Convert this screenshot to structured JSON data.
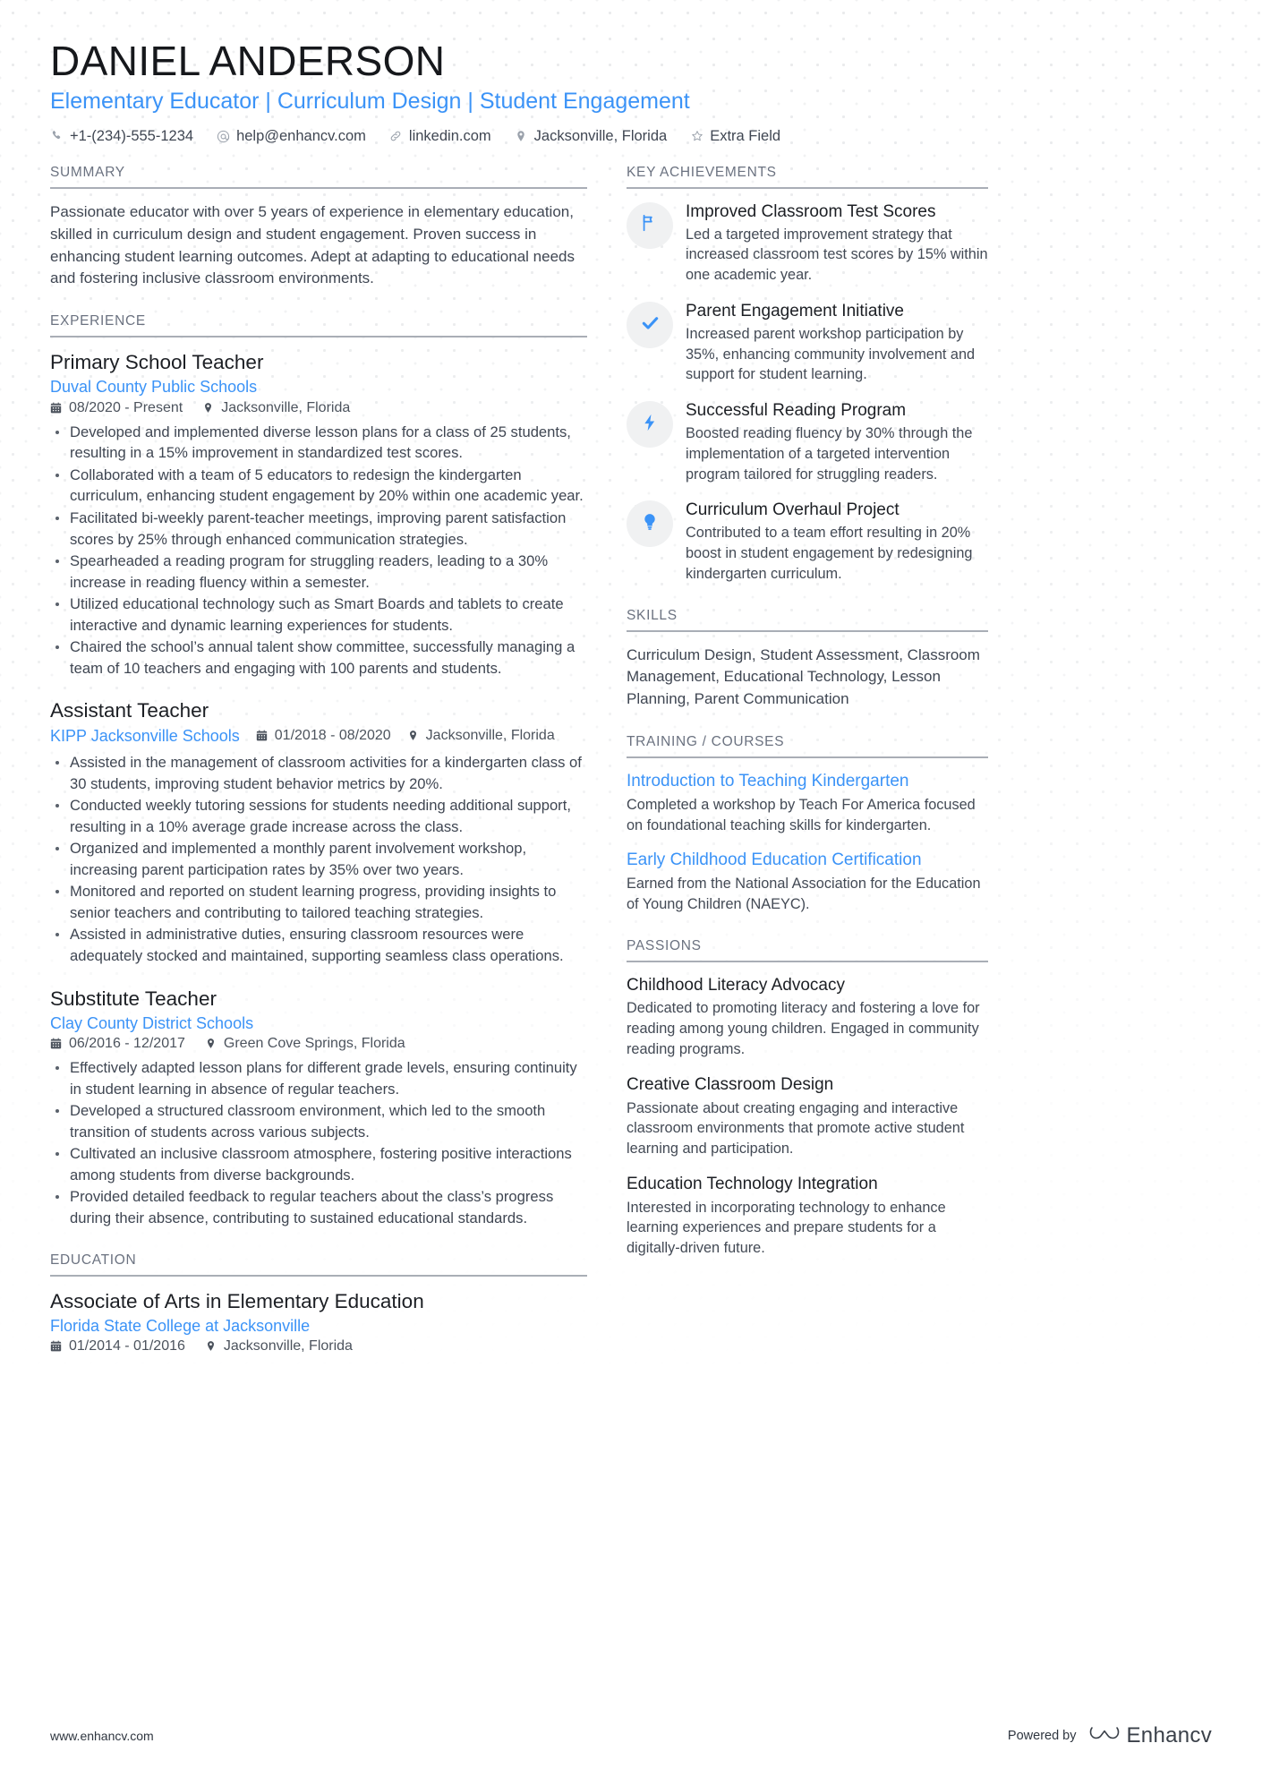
{
  "header": {
    "name": "DANIEL ANDERSON",
    "headline": "Elementary Educator | Curriculum Design | Student Engagement",
    "contacts": [
      {
        "icon": "phone-icon",
        "text": "+1-(234)-555-1234"
      },
      {
        "icon": "email-icon",
        "text": "help@enhancv.com"
      },
      {
        "icon": "link-icon",
        "text": "linkedin.com"
      },
      {
        "icon": "location-icon",
        "text": "Jacksonville, Florida"
      },
      {
        "icon": "star-icon",
        "text": "Extra Field"
      }
    ]
  },
  "summary": {
    "title": "SUMMARY",
    "text": "Passionate educator with over 5 years of experience in elementary education, skilled in curriculum design and student engagement. Proven success in enhancing student learning outcomes. Adept at adapting to educational needs and fostering inclusive classroom environments."
  },
  "experience": {
    "title": "EXPERIENCE",
    "jobs": [
      {
        "title": "Primary School Teacher",
        "company": "Duval County Public Schools",
        "dates": "08/2020 - Present",
        "location": "Jacksonville, Florida",
        "inline_meta": false,
        "bullets": [
          "Developed and implemented diverse lesson plans for a class of 25 students, resulting in a 15% improvement in standardized test scores.",
          "Collaborated with a team of 5 educators to redesign the kindergarten curriculum, enhancing student engagement by 20% within one academic year.",
          "Facilitated bi-weekly parent-teacher meetings, improving parent satisfaction scores by 25% through enhanced communication strategies.",
          "Spearheaded a reading program for struggling readers, leading to a 30% increase in reading fluency within a semester.",
          "Utilized educational technology such as Smart Boards and tablets to create interactive and dynamic learning experiences for students.",
          "Chaired the school’s annual talent show committee, successfully managing a team of 10 teachers and engaging with 100 parents and students."
        ]
      },
      {
        "title": "Assistant Teacher",
        "company": "KIPP Jacksonville Schools",
        "dates": "01/2018 - 08/2020",
        "location": "Jacksonville, Florida",
        "inline_meta": true,
        "bullets": [
          "Assisted in the management of classroom activities for a kindergarten class of 30 students, improving student behavior metrics by 20%.",
          "Conducted weekly tutoring sessions for students needing additional support, resulting in a 10% average grade increase across the class.",
          "Organized and implemented a monthly parent involvement workshop, increasing parent participation rates by 35% over two years.",
          "Monitored and reported on student learning progress, providing insights to senior teachers and contributing to tailored teaching strategies.",
          "Assisted in administrative duties, ensuring classroom resources were adequately stocked and maintained, supporting seamless class operations."
        ]
      },
      {
        "title": "Substitute Teacher",
        "company": "Clay County District Schools",
        "dates": "06/2016 - 12/2017",
        "location": "Green Cove Springs, Florida",
        "inline_meta": false,
        "bullets": [
          "Effectively adapted lesson plans for different grade levels, ensuring continuity in student learning in absence of regular teachers.",
          "Developed a structured classroom environment, which led to the smooth transition of students across various subjects.",
          "Cultivated an inclusive classroom atmosphere, fostering positive interactions among students from diverse backgrounds.",
          "Provided detailed feedback to regular teachers about the class’s progress during their absence, contributing to sustained educational standards."
        ]
      }
    ]
  },
  "education": {
    "title": "EDUCATION",
    "entries": [
      {
        "degree": "Associate of Arts in Elementary Education",
        "school": "Florida State College at Jacksonville",
        "dates": "01/2014 - 01/2016",
        "location": "Jacksonville, Florida"
      }
    ]
  },
  "achievements": {
    "title": "KEY ACHIEVEMENTS",
    "items": [
      {
        "icon": "flag-icon",
        "title": "Improved Classroom Test Scores",
        "desc": "Led a targeted improvement strategy that increased classroom test scores by 15% within one academic year."
      },
      {
        "icon": "check-icon",
        "title": "Parent Engagement Initiative",
        "desc": "Increased parent workshop participation by 35%, enhancing community involvement and support for student learning."
      },
      {
        "icon": "bolt-icon",
        "title": "Successful Reading Program",
        "desc": "Boosted reading fluency by 30% through the implementation of a targeted intervention program tailored for struggling readers."
      },
      {
        "icon": "lightbulb-icon",
        "title": "Curriculum Overhaul Project",
        "desc": "Contributed to a team effort resulting in 20% boost in student engagement by redesigning kindergarten curriculum."
      }
    ]
  },
  "skills": {
    "title": "SKILLS",
    "text": "Curriculum Design, Student Assessment, Classroom Management, Educational Technology, Lesson Planning, Parent Communication"
  },
  "training": {
    "title": "TRAINING / COURSES",
    "items": [
      {
        "title": "Introduction to Teaching Kindergarten",
        "desc": "Completed a workshop by Teach For America focused on foundational teaching skills for kindergarten."
      },
      {
        "title": "Early Childhood Education Certification",
        "desc": "Earned from the National Association for the Education of Young Children (NAEYC)."
      }
    ]
  },
  "passions": {
    "title": "PASSIONS",
    "items": [
      {
        "title": "Childhood Literacy Advocacy",
        "desc": "Dedicated to promoting literacy and fostering a love for reading among young children. Engaged in community reading programs."
      },
      {
        "title": "Creative Classroom Design",
        "desc": "Passionate about creating engaging and interactive classroom environments that promote active student learning and participation."
      },
      {
        "title": "Education Technology Integration",
        "desc": "Interested in incorporating technology to enhance learning experiences and prepare students for a digitally-driven future."
      }
    ]
  },
  "footer": {
    "url": "www.enhancv.com",
    "powered_by": "Powered by",
    "brand": "Enhancv"
  },
  "colors": {
    "accent": "#3b93f7",
    "text": "#3f4652",
    "heading": "#1c1f24",
    "section_label": "#6b7280",
    "rule": "#a9aeb6",
    "badge_bg": "#f0f1f2"
  }
}
